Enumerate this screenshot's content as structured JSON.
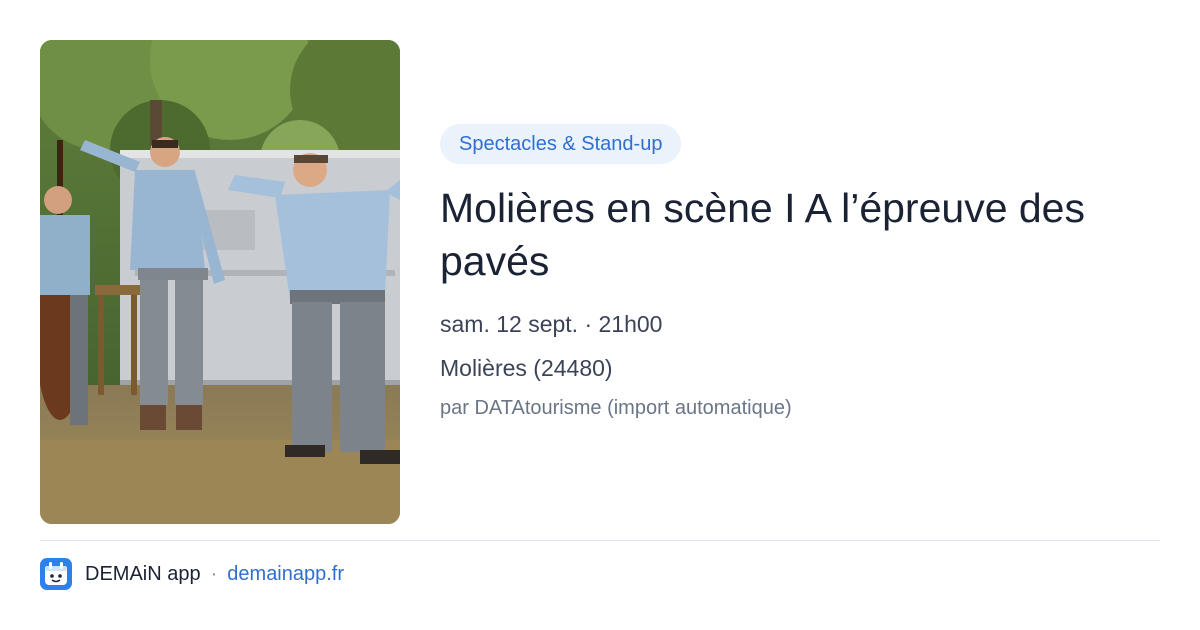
{
  "event": {
    "category": "Spectacles & Stand-up",
    "title": "Molières en scène I A l’épreuve des pavés",
    "date": "sam. 12 sept. · 21h00",
    "place": "Molières (24480)",
    "author": "par DATAtourisme (import automatique)"
  },
  "footer": {
    "app_name": "DEMAiN app",
    "separator": "·",
    "domain": "demainapp.fr",
    "icon": "demain-app-icon"
  },
  "colors": {
    "accent": "#2f6fd0",
    "badge_bg": "#eaf2fc",
    "title": "#1a2233",
    "meta": "#3b4457",
    "muted": "#6b7585",
    "divider": "#dde3ea"
  }
}
